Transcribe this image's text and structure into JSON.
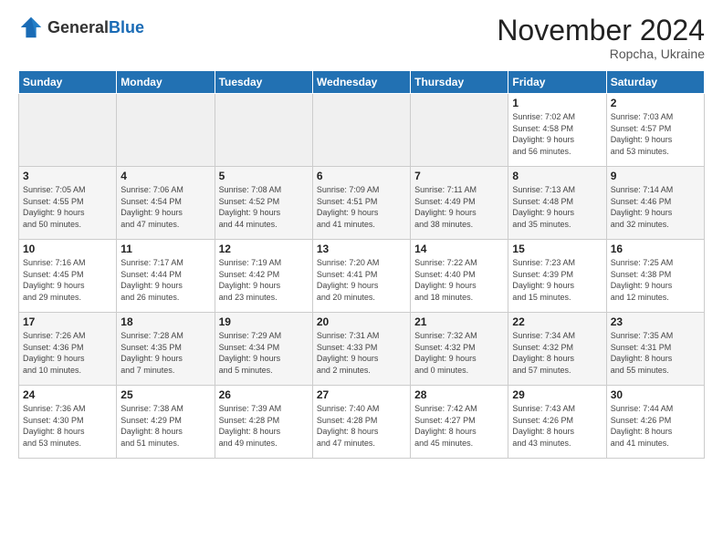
{
  "header": {
    "logo_general": "General",
    "logo_blue": "Blue",
    "month_title": "November 2024",
    "subtitle": "Ropcha, Ukraine"
  },
  "weekdays": [
    "Sunday",
    "Monday",
    "Tuesday",
    "Wednesday",
    "Thursday",
    "Friday",
    "Saturday"
  ],
  "weeks": [
    [
      {
        "day": "",
        "info": ""
      },
      {
        "day": "",
        "info": ""
      },
      {
        "day": "",
        "info": ""
      },
      {
        "day": "",
        "info": ""
      },
      {
        "day": "",
        "info": ""
      },
      {
        "day": "1",
        "info": "Sunrise: 7:02 AM\nSunset: 4:58 PM\nDaylight: 9 hours\nand 56 minutes."
      },
      {
        "day": "2",
        "info": "Sunrise: 7:03 AM\nSunset: 4:57 PM\nDaylight: 9 hours\nand 53 minutes."
      }
    ],
    [
      {
        "day": "3",
        "info": "Sunrise: 7:05 AM\nSunset: 4:55 PM\nDaylight: 9 hours\nand 50 minutes."
      },
      {
        "day": "4",
        "info": "Sunrise: 7:06 AM\nSunset: 4:54 PM\nDaylight: 9 hours\nand 47 minutes."
      },
      {
        "day": "5",
        "info": "Sunrise: 7:08 AM\nSunset: 4:52 PM\nDaylight: 9 hours\nand 44 minutes."
      },
      {
        "day": "6",
        "info": "Sunrise: 7:09 AM\nSunset: 4:51 PM\nDaylight: 9 hours\nand 41 minutes."
      },
      {
        "day": "7",
        "info": "Sunrise: 7:11 AM\nSunset: 4:49 PM\nDaylight: 9 hours\nand 38 minutes."
      },
      {
        "day": "8",
        "info": "Sunrise: 7:13 AM\nSunset: 4:48 PM\nDaylight: 9 hours\nand 35 minutes."
      },
      {
        "day": "9",
        "info": "Sunrise: 7:14 AM\nSunset: 4:46 PM\nDaylight: 9 hours\nand 32 minutes."
      }
    ],
    [
      {
        "day": "10",
        "info": "Sunrise: 7:16 AM\nSunset: 4:45 PM\nDaylight: 9 hours\nand 29 minutes."
      },
      {
        "day": "11",
        "info": "Sunrise: 7:17 AM\nSunset: 4:44 PM\nDaylight: 9 hours\nand 26 minutes."
      },
      {
        "day": "12",
        "info": "Sunrise: 7:19 AM\nSunset: 4:42 PM\nDaylight: 9 hours\nand 23 minutes."
      },
      {
        "day": "13",
        "info": "Sunrise: 7:20 AM\nSunset: 4:41 PM\nDaylight: 9 hours\nand 20 minutes."
      },
      {
        "day": "14",
        "info": "Sunrise: 7:22 AM\nSunset: 4:40 PM\nDaylight: 9 hours\nand 18 minutes."
      },
      {
        "day": "15",
        "info": "Sunrise: 7:23 AM\nSunset: 4:39 PM\nDaylight: 9 hours\nand 15 minutes."
      },
      {
        "day": "16",
        "info": "Sunrise: 7:25 AM\nSunset: 4:38 PM\nDaylight: 9 hours\nand 12 minutes."
      }
    ],
    [
      {
        "day": "17",
        "info": "Sunrise: 7:26 AM\nSunset: 4:36 PM\nDaylight: 9 hours\nand 10 minutes."
      },
      {
        "day": "18",
        "info": "Sunrise: 7:28 AM\nSunset: 4:35 PM\nDaylight: 9 hours\nand 7 minutes."
      },
      {
        "day": "19",
        "info": "Sunrise: 7:29 AM\nSunset: 4:34 PM\nDaylight: 9 hours\nand 5 minutes."
      },
      {
        "day": "20",
        "info": "Sunrise: 7:31 AM\nSunset: 4:33 PM\nDaylight: 9 hours\nand 2 minutes."
      },
      {
        "day": "21",
        "info": "Sunrise: 7:32 AM\nSunset: 4:32 PM\nDaylight: 9 hours\nand 0 minutes."
      },
      {
        "day": "22",
        "info": "Sunrise: 7:34 AM\nSunset: 4:32 PM\nDaylight: 8 hours\nand 57 minutes."
      },
      {
        "day": "23",
        "info": "Sunrise: 7:35 AM\nSunset: 4:31 PM\nDaylight: 8 hours\nand 55 minutes."
      }
    ],
    [
      {
        "day": "24",
        "info": "Sunrise: 7:36 AM\nSunset: 4:30 PM\nDaylight: 8 hours\nand 53 minutes."
      },
      {
        "day": "25",
        "info": "Sunrise: 7:38 AM\nSunset: 4:29 PM\nDaylight: 8 hours\nand 51 minutes."
      },
      {
        "day": "26",
        "info": "Sunrise: 7:39 AM\nSunset: 4:28 PM\nDaylight: 8 hours\nand 49 minutes."
      },
      {
        "day": "27",
        "info": "Sunrise: 7:40 AM\nSunset: 4:28 PM\nDaylight: 8 hours\nand 47 minutes."
      },
      {
        "day": "28",
        "info": "Sunrise: 7:42 AM\nSunset: 4:27 PM\nDaylight: 8 hours\nand 45 minutes."
      },
      {
        "day": "29",
        "info": "Sunrise: 7:43 AM\nSunset: 4:26 PM\nDaylight: 8 hours\nand 43 minutes."
      },
      {
        "day": "30",
        "info": "Sunrise: 7:44 AM\nSunset: 4:26 PM\nDaylight: 8 hours\nand 41 minutes."
      }
    ]
  ]
}
